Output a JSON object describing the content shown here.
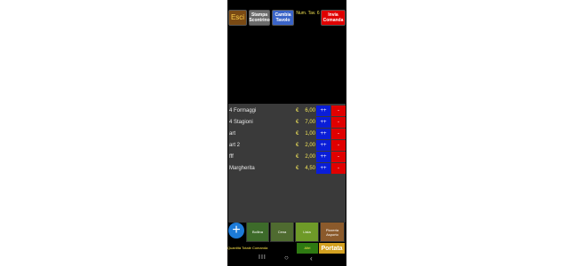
{
  "top": {
    "esci": "Esci",
    "stampa": "Stampa Scontrino",
    "cambia": "Cambia Tavolo",
    "num_label": "Num. Tav. 6",
    "invia": "Invia Comanda"
  },
  "items": [
    {
      "name": "4 Formaggi",
      "currency": "€",
      "price": "6,00",
      "plus": "++",
      "minus": "-"
    },
    {
      "name": "4 Stagioni",
      "currency": "€",
      "price": "7,00",
      "plus": "++",
      "minus": "-"
    },
    {
      "name": "art",
      "currency": "€",
      "price": "1,00",
      "plus": "++",
      "minus": "-"
    },
    {
      "name": "art 2",
      "currency": "€",
      "price": "2,00",
      "plus": "++",
      "minus": "-"
    },
    {
      "name": "fff",
      "currency": "€",
      "price": "2,00",
      "plus": "++",
      "minus": "-"
    },
    {
      "name": "Margherita",
      "currency": "€",
      "price": "4,50",
      "plus": "++",
      "minus": "-"
    }
  ],
  "bottom": {
    "fab_icon": "+",
    "bollina": "Bollina",
    "cena": "Cena",
    "lista": "Lista",
    "pizzeria": "Pizzeria Asporto",
    "qty_label": "Quantità Totale Comanda",
    "extra": "Altri",
    "pagina": "Portata"
  },
  "navbar": {
    "pause_icon": "III",
    "home_icon": "○",
    "back_icon": "‹"
  },
  "colors": {
    "background": "#000000",
    "list_bg": "#3a3a3a",
    "plus": "#0a1ed8",
    "minus": "#e00000",
    "price_text": "#f3e65a"
  }
}
